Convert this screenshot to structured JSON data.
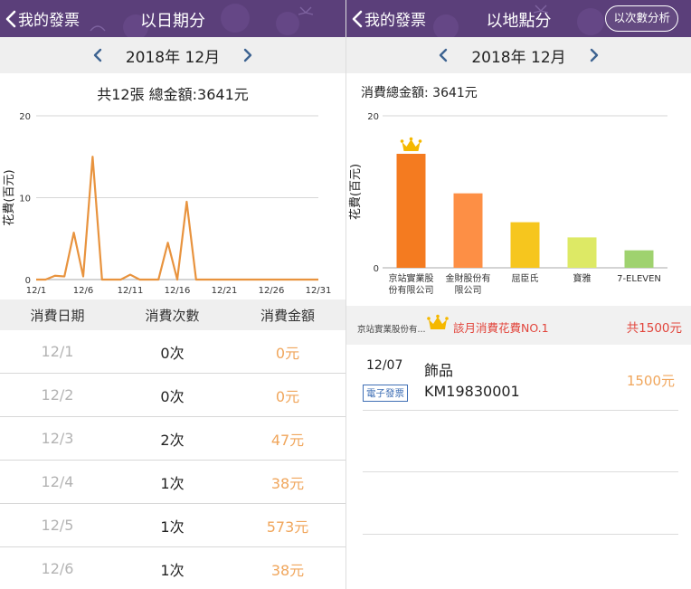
{
  "left": {
    "nav": {
      "back_label": "我的發票",
      "title": "以日期分"
    },
    "month": {
      "label": "2018年 12月"
    },
    "summary": "共12張 總金額:3641元",
    "chart_data": {
      "type": "line",
      "ylabel": "花費(百元)",
      "ylim": [
        0,
        20
      ],
      "yticks": [
        "0",
        "10",
        "20"
      ],
      "xticks": [
        {
          "day": 1,
          "label": "12/1"
        },
        {
          "day": 6,
          "label": "12/6"
        },
        {
          "day": 11,
          "label": "12/11"
        },
        {
          "day": 16,
          "label": "12/16"
        },
        {
          "day": 21,
          "label": "12/21"
        },
        {
          "day": 26,
          "label": "12/26"
        },
        {
          "day": 31,
          "label": "12/31"
        }
      ],
      "x": [
        1,
        2,
        3,
        4,
        5,
        6,
        7,
        8,
        9,
        10,
        11,
        12,
        13,
        14,
        15,
        16,
        17,
        18,
        19,
        20,
        21,
        22,
        23,
        24,
        25,
        26,
        27,
        28,
        29,
        30,
        31
      ],
      "values": [
        0,
        0,
        0.47,
        0.38,
        5.73,
        0.38,
        15,
        0,
        0,
        0,
        0.6,
        0,
        0,
        0,
        4.5,
        0,
        9.5,
        0,
        0,
        0,
        0,
        0,
        0,
        0,
        0,
        0,
        0,
        0,
        0,
        0,
        0
      ],
      "color": "#e8933e"
    },
    "table": {
      "headers": [
        "消費日期",
        "消費次數",
        "消費金額"
      ],
      "rows": [
        [
          "12/1",
          "0次",
          "0元"
        ],
        [
          "12/2",
          "0次",
          "0元"
        ],
        [
          "12/3",
          "2次",
          "47元"
        ],
        [
          "12/4",
          "1次",
          "38元"
        ],
        [
          "12/5",
          "1次",
          "573元"
        ],
        [
          "12/6",
          "1次",
          "38元"
        ]
      ]
    }
  },
  "right": {
    "nav": {
      "back_label": "我的發票",
      "title": "以地點分",
      "button_label": "以次數分析"
    },
    "month": {
      "label": "2018年 12月"
    },
    "summary": "消費總金額: 3641元",
    "chart_data": {
      "type": "bar",
      "ylabel": "花費(百元)",
      "ylim": [
        0,
        20
      ],
      "yticks": [
        "0",
        "20"
      ],
      "categories": [
        [
          "京站實業股",
          "份有限公司"
        ],
        [
          "金財股份有",
          "限公司"
        ],
        [
          "屈臣氏"
        ],
        [
          "寶雅"
        ],
        [
          "7-ELEVEN"
        ]
      ],
      "values": [
        15,
        9.8,
        6,
        4,
        2.3
      ],
      "colors": [
        "#f47b20",
        "#fd8f45",
        "#f6c61e",
        "#dde965",
        "#9fd26f"
      ],
      "crown_on": 0
    },
    "top_store": {
      "name": "京站實業股份有...",
      "label": "該月消費花費NO.1",
      "total": "共1500元"
    },
    "invoice": {
      "date": "12/07",
      "item": "飾品",
      "badge": "電子發票",
      "number": "KM19830001",
      "amount": "1500元"
    }
  },
  "colors": {
    "nav_bg": "#5b3f7a",
    "month_bar_bg": "#efefef",
    "accent_orange": "#f0a65c",
    "alert_red": "#e2453c",
    "crown": "#f5b800"
  }
}
